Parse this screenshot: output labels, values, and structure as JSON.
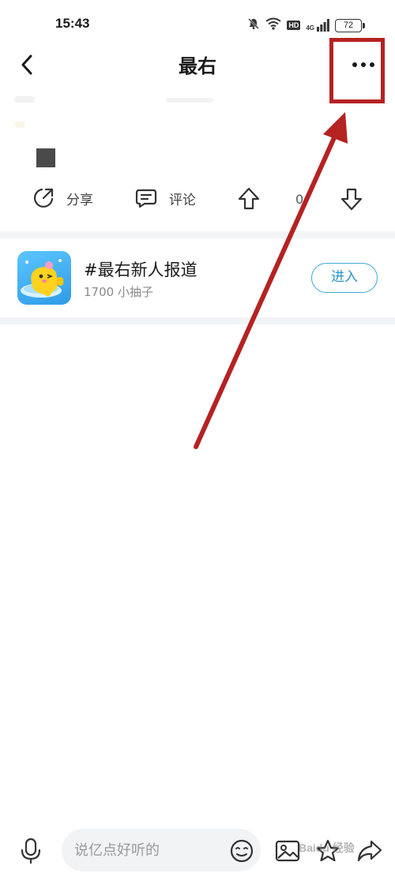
{
  "status_bar": {
    "time": "15:43",
    "network_label": "4G",
    "hd_label": "HD",
    "battery_level": "72"
  },
  "nav": {
    "title": "最右"
  },
  "actions": {
    "share_label": "分享",
    "comment_label": "评论",
    "vote_count": "0"
  },
  "topic": {
    "title": "#最右新人报道",
    "subtitle": "1700 小抽子",
    "enter_label": "进入"
  },
  "bottom_bar": {
    "input_placeholder": "说亿点好听的"
  },
  "watermark": "Baidu 经验",
  "colors": {
    "annotation_red": "#b52222",
    "enter_blue": "#2a95c8",
    "divider_gray": "#f3f4f6"
  }
}
